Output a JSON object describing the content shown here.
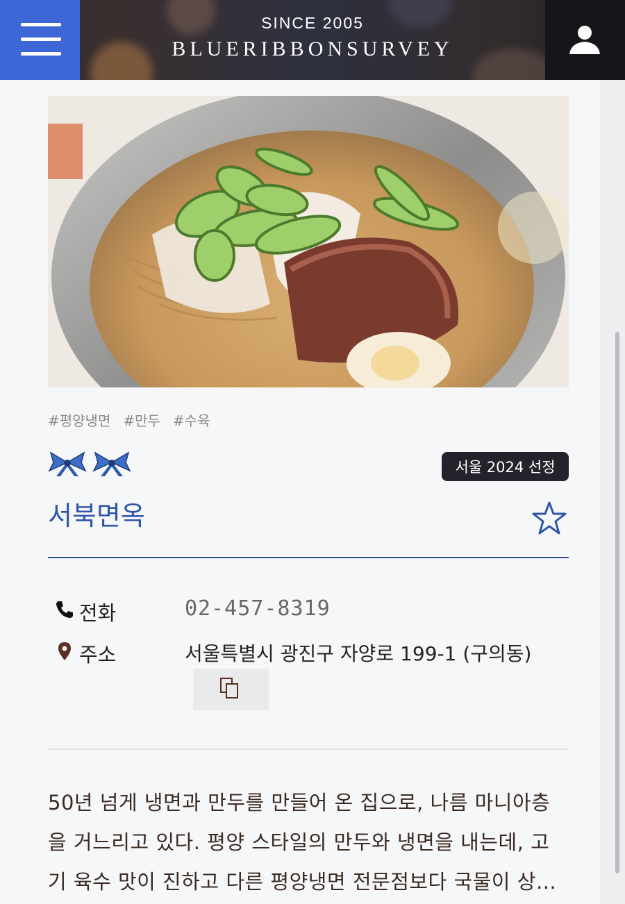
{
  "header": {
    "since": "SINCE 2005",
    "logo": "BLUERIBBONSURVEY"
  },
  "restaurant": {
    "tags": [
      "#평양냉면",
      "#만두",
      "#수육"
    ],
    "ribbon_count": 2,
    "badge": "서울 2024 선정",
    "name": "서북면옥"
  },
  "info": {
    "phone_label": "전화",
    "phone": "02-457-8319",
    "address_label": "주소",
    "address": "서울특별시 광진구 자양로 199-1 (구의동)"
  },
  "description": "50년 넘게 냉면과 만두를 만들어 온 집으로, 나름 마니아층을 거느리고 있다. 평양 스타일의 만두와 냉면을 내는데, 고기 육수 맛이 진하고 다른 평양냉면 전문점보다 국물이 상…",
  "colors": {
    "accent_blue": "#2f55a4",
    "menu_blue": "#3d67d6",
    "badge_bg": "#22232b"
  },
  "icons": [
    "menu-icon",
    "user-icon",
    "ribbon-icon",
    "star-outline-icon",
    "phone-icon",
    "location-pin-icon",
    "copy-icon"
  ]
}
